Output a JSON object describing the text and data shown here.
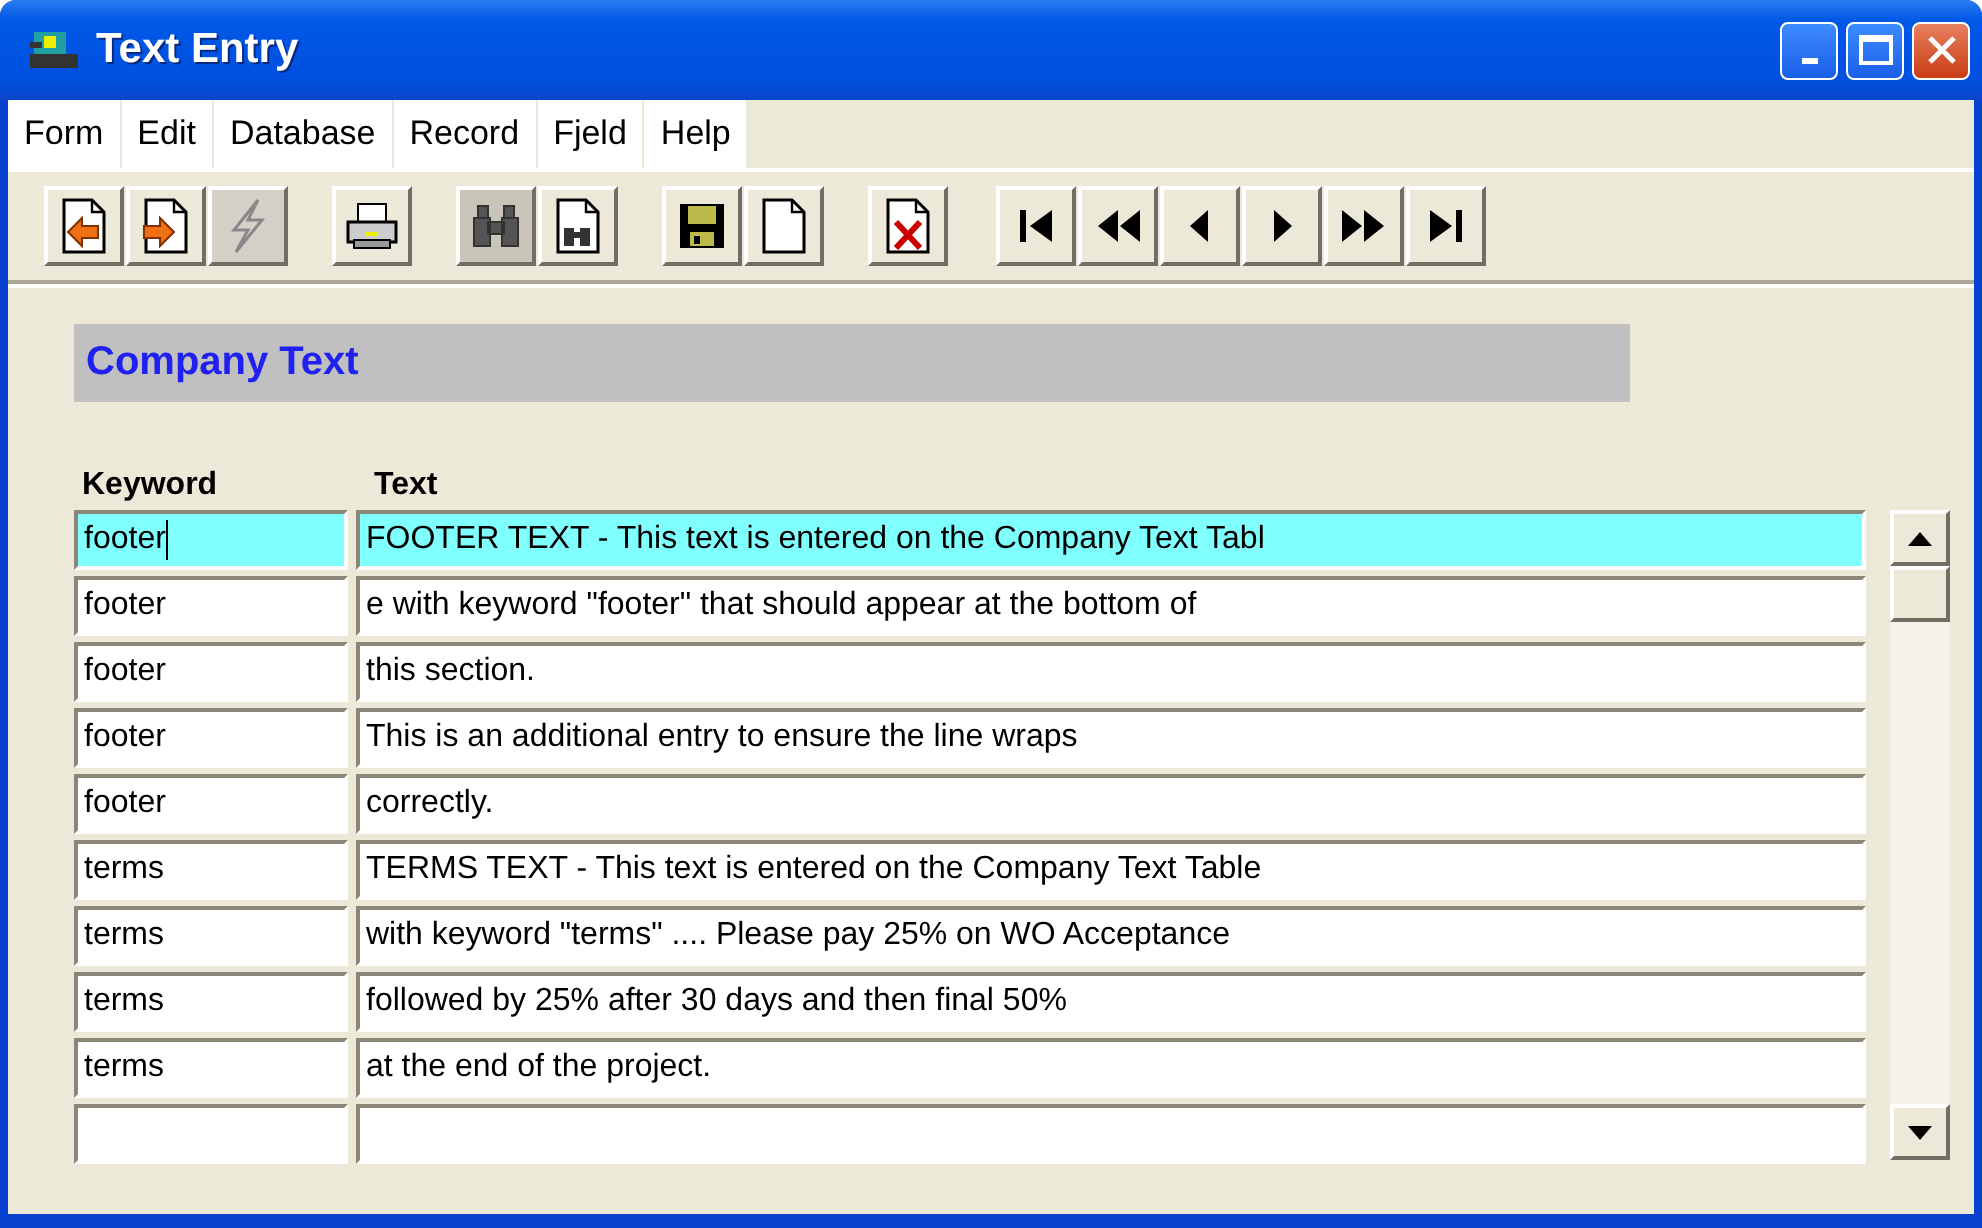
{
  "window": {
    "title": "Text Entry"
  },
  "menu": [
    {
      "label": "Form"
    },
    {
      "label": "Edit"
    },
    {
      "label": "Database"
    },
    {
      "label": "Record"
    },
    {
      "label": "Fjeld"
    },
    {
      "label": "Help"
    }
  ],
  "toolbar": [
    [
      {
        "kind": "import",
        "disabled": false,
        "pressed": false
      },
      {
        "kind": "export",
        "disabled": false,
        "pressed": false
      },
      {
        "kind": "lightning",
        "disabled": true,
        "pressed": false
      }
    ],
    [
      {
        "kind": "print",
        "disabled": false,
        "pressed": false
      }
    ],
    [
      {
        "kind": "find",
        "disabled": false,
        "pressed": true
      },
      {
        "kind": "find-page",
        "disabled": false,
        "pressed": false
      }
    ],
    [
      {
        "kind": "save",
        "disabled": false,
        "pressed": false
      },
      {
        "kind": "new",
        "disabled": false,
        "pressed": false
      }
    ],
    [
      {
        "kind": "delete",
        "disabled": false,
        "pressed": false
      }
    ],
    [
      {
        "kind": "first",
        "disabled": false,
        "pressed": false
      },
      {
        "kind": "prev-page",
        "disabled": false,
        "pressed": false
      },
      {
        "kind": "prev",
        "disabled": false,
        "pressed": false
      },
      {
        "kind": "next",
        "disabled": false,
        "pressed": false
      },
      {
        "kind": "next-page",
        "disabled": false,
        "pressed": false
      },
      {
        "kind": "last",
        "disabled": false,
        "pressed": false
      }
    ]
  ],
  "section_title": "Company Text",
  "table": {
    "columns": [
      "Keyword",
      "Text"
    ],
    "rows": [
      {
        "keyword": "footer",
        "text": "FOOTER TEXT - This text is entered on the Company Text Tabl",
        "selected": true,
        "cursor": true
      },
      {
        "keyword": "footer",
        "text": "e with keyword \"footer\" that should appear at the bottom of",
        "selected": false,
        "cursor": false
      },
      {
        "keyword": "footer",
        "text": "this section.",
        "selected": false,
        "cursor": false
      },
      {
        "keyword": "footer",
        "text": "This is an additional entry to ensure the line wraps",
        "selected": false,
        "cursor": false
      },
      {
        "keyword": "footer",
        "text": "correctly.",
        "selected": false,
        "cursor": false
      },
      {
        "keyword": "terms",
        "text": "TERMS TEXT - This text is entered on the Company Text Table",
        "selected": false,
        "cursor": false
      },
      {
        "keyword": "terms",
        "text": "with keyword \"terms\" .... Please pay 25% on WO Acceptance",
        "selected": false,
        "cursor": false
      },
      {
        "keyword": "terms",
        "text": "followed by 25% after 30 days and then final 50%",
        "selected": false,
        "cursor": false
      },
      {
        "keyword": "terms",
        "text": "at the end of the project.",
        "selected": false,
        "cursor": false
      },
      {
        "selected": false,
        "cursor": false
      }
    ]
  }
}
